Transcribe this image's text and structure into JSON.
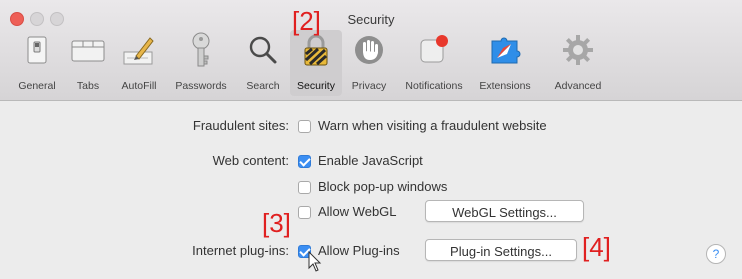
{
  "window": {
    "title": "Security"
  },
  "toolbar": {
    "tabs": [
      {
        "label": "General",
        "icon": "general-switch-icon"
      },
      {
        "label": "Tabs",
        "icon": "tabs-icon"
      },
      {
        "label": "AutoFill",
        "icon": "pencil-form-icon"
      },
      {
        "label": "Passwords",
        "icon": "key-icon"
      },
      {
        "label": "Search",
        "icon": "magnifier-icon"
      },
      {
        "label": "Security",
        "icon": "padlock-icon",
        "selected": true
      },
      {
        "label": "Privacy",
        "icon": "hand-icon"
      },
      {
        "label": "Notifications",
        "icon": "notification-badge-icon"
      },
      {
        "label": "Extensions",
        "icon": "puzzle-compass-icon"
      },
      {
        "label": "Advanced",
        "icon": "gear-icon"
      }
    ]
  },
  "security": {
    "fraudulent": {
      "label": "Fraudulent sites:",
      "warn_text": "Warn when visiting a fraudulent website",
      "warn_checked": false
    },
    "web_content": {
      "label": "Web content:",
      "enable_js_text": "Enable JavaScript",
      "enable_js_checked": true,
      "block_popups_text": "Block pop-up windows",
      "block_popups_checked": false,
      "allow_webgl_text": "Allow WebGL",
      "allow_webgl_checked": false,
      "webgl_settings_label": "WebGL Settings..."
    },
    "plugins": {
      "label": "Internet plug-ins:",
      "allow_plugins_text": "Allow Plug-ins",
      "allow_plugins_checked": true,
      "plugin_settings_label": "Plug-in Settings..."
    },
    "help_label": "?"
  },
  "annotations": {
    "a2": "[2]",
    "a3": "[3]",
    "a4": "[4]"
  },
  "colors": {
    "accent": "#3b8ef2",
    "annotation": "#e02020"
  }
}
